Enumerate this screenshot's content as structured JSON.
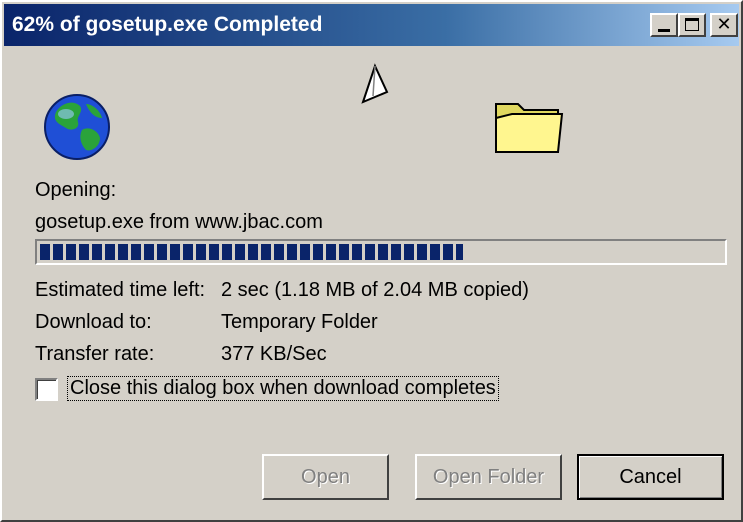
{
  "window": {
    "title": "62% of gosetup.exe Completed",
    "progress_percent": 62
  },
  "titlebar_buttons": {
    "minimize_icon": "minimize-icon",
    "maximize_icon": "maximize-icon",
    "close_glyph": "✕"
  },
  "icons": {
    "globe": "globe-icon",
    "paper": "flying-paper-icon",
    "folder": "folder-icon"
  },
  "status": {
    "opening_label": "Opening:",
    "file_source": "gosetup.exe from www.jbac.com"
  },
  "progress": {
    "fraction": 0.62
  },
  "details": {
    "time_left_label": "Estimated time left:",
    "time_left_value": "2 sec (1.18 MB of 2.04 MB copied)",
    "download_to_label": "Download to:",
    "download_to_value": "Temporary Folder",
    "transfer_rate_label": "Transfer rate:",
    "transfer_rate_value": "377 KB/Sec"
  },
  "options": {
    "close_when_done_label": "Close this dialog box when download completes",
    "close_when_done_checked": false
  },
  "buttons": {
    "open_label": "Open",
    "open_folder_label": "Open Folder",
    "cancel_label": "Cancel"
  }
}
